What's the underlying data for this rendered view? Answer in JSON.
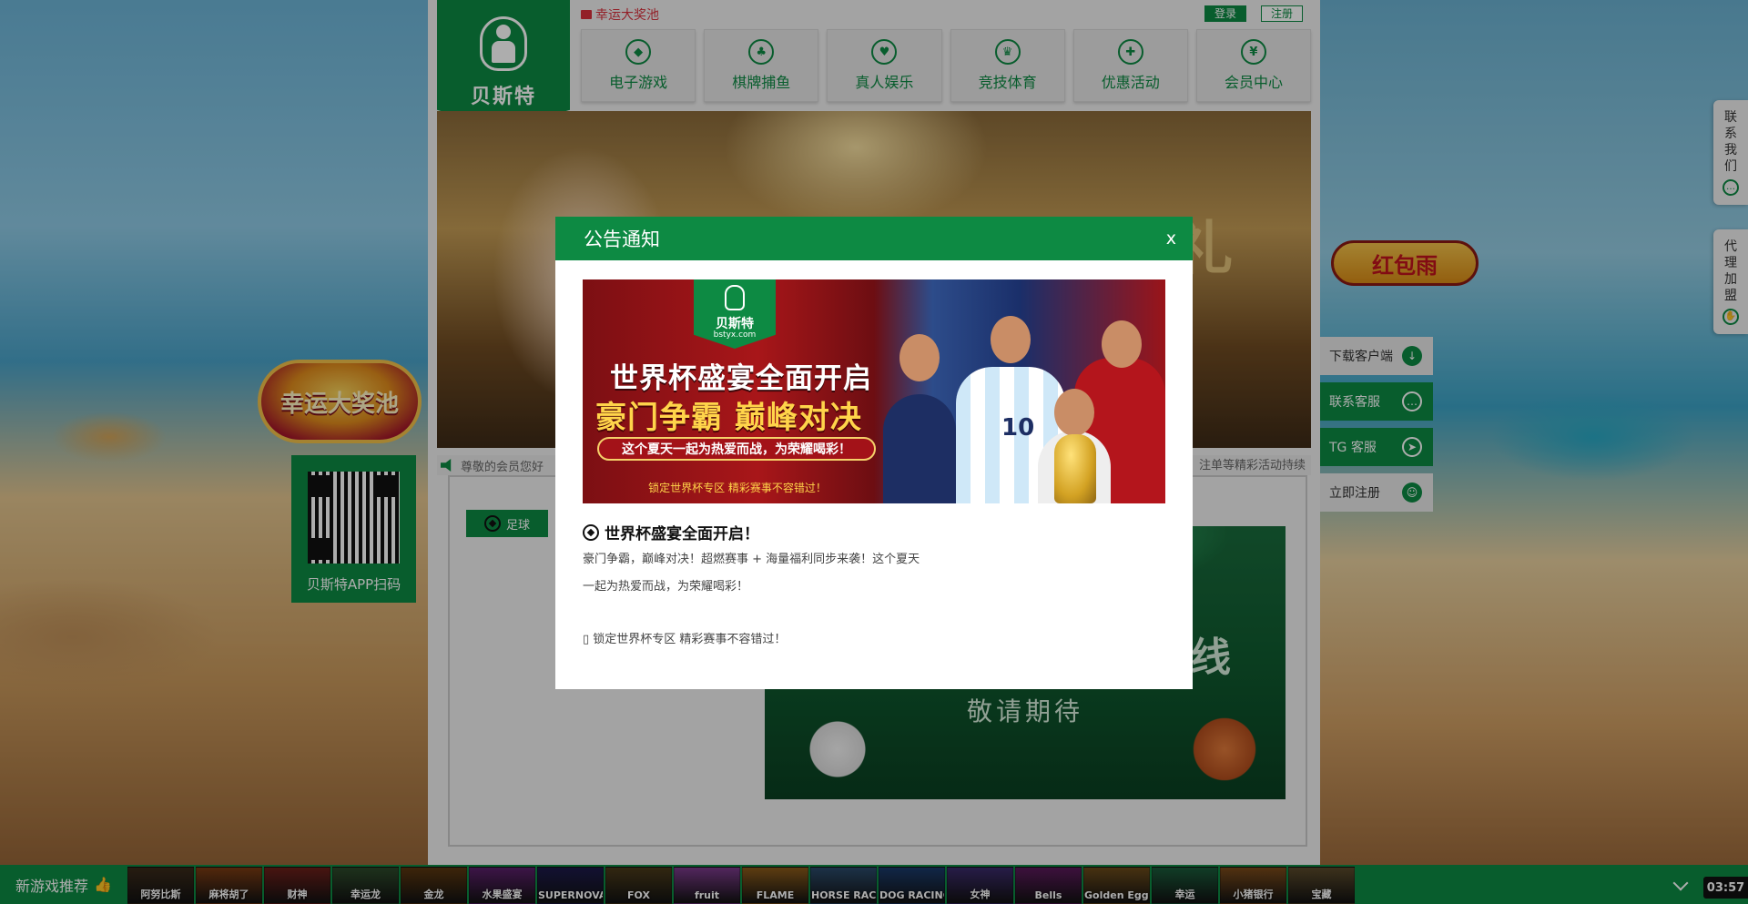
{
  "header": {
    "brand_name": "贝斯特",
    "jackpot_link": "幸运大奖池",
    "login": "登录",
    "register": "注册"
  },
  "nav": [
    {
      "label": "电子游戏",
      "icon": "diamond-icon",
      "glyph": "◆"
    },
    {
      "label": "棋牌捕鱼",
      "icon": "cards-icon",
      "glyph": "♣"
    },
    {
      "label": "真人娱乐",
      "icon": "heart-icon",
      "glyph": "♥"
    },
    {
      "label": "竞技体育",
      "icon": "crown-icon",
      "glyph": "♛"
    },
    {
      "label": "优惠活动",
      "icon": "gift-icon",
      "glyph": "✚"
    },
    {
      "label": "会员中心",
      "icon": "yen-icon",
      "glyph": "¥"
    }
  ],
  "banner": {
    "chars": "礼"
  },
  "marquee": {
    "text": "尊敬的会员您好",
    "tail": "注单等精彩活动持续"
  },
  "sports": {
    "tab_label": "足球",
    "soon": "敬请期待",
    "mark": "线"
  },
  "left_widgets": {
    "lucky_pool": "幸运大奖池",
    "qr_label": "贝斯特APP扫码"
  },
  "right_widgets": {
    "red_packet": "红包雨",
    "download": "下载客户端",
    "support": "联系客服",
    "tg_support": "TG 客服",
    "register_now": "立即注册",
    "contact_us": [
      "联",
      "系",
      "我",
      "们"
    ],
    "agent_join": [
      "代",
      "理",
      "加",
      "盟"
    ]
  },
  "bottom_bar": {
    "label": "新游戏推荐",
    "clock": "03:57",
    "thumbs": [
      {
        "label": "阿努比斯",
        "color": "#3a2a1a"
      },
      {
        "label": "麻将胡了",
        "color": "#7a3b12"
      },
      {
        "label": "财神",
        "color": "#6b1f1a"
      },
      {
        "label": "幸运龙",
        "color": "#2d4a2a"
      },
      {
        "label": "金龙",
        "color": "#5a3610"
      },
      {
        "label": "水果盛宴",
        "color": "#5a1f6a"
      },
      {
        "label": "SUPERNOVA",
        "color": "#1c1a4a"
      },
      {
        "label": "FOX",
        "color": "#4a3a1a"
      },
      {
        "label": "fruit",
        "color": "#7a3a8a"
      },
      {
        "label": "FLAME",
        "color": "#8a5a1a"
      },
      {
        "label": "HORSE RACING",
        "color": "#2a4a6a"
      },
      {
        "label": "DOG RACING",
        "color": "#1a3a6a"
      },
      {
        "label": "女神",
        "color": "#3a2a6a"
      },
      {
        "label": "Bells",
        "color": "#5a1a5a"
      },
      {
        "label": "Golden Eggs",
        "color": "#6a4a1a"
      },
      {
        "label": "幸运",
        "color": "#1a5a3a"
      },
      {
        "label": "小猪银行",
        "color": "#7a4a1a"
      },
      {
        "label": "宝藏",
        "color": "#5a4a2a"
      }
    ]
  },
  "modal": {
    "title": "公告通知",
    "close": "x",
    "banner": {
      "logo_name": "贝斯特",
      "logo_site": "bstyx.com",
      "headline": "世界杯盛宴全面开启",
      "subheadline": "豪门争霸 巅峰对决",
      "pill": "这个夏天一起为热爱而战，为荣耀喝彩！",
      "footer": "锁定世界杯专区  精彩赛事不容错过！",
      "jersey_number": "10"
    },
    "notice_title": "世界杯盛宴全面开启！",
    "notice_line1": "豪门争霸，巅峰对决！超燃赛事 + 海量福利同步来袭！这个夏天",
    "notice_line2": "一起为热爱而战，为荣耀喝彩！",
    "notice_footer": "▯ 锁定世界杯专区 精彩赛事不容错过！"
  },
  "colors": {
    "brand_green": "#0d8a43",
    "accent_red": "#d9303c"
  }
}
